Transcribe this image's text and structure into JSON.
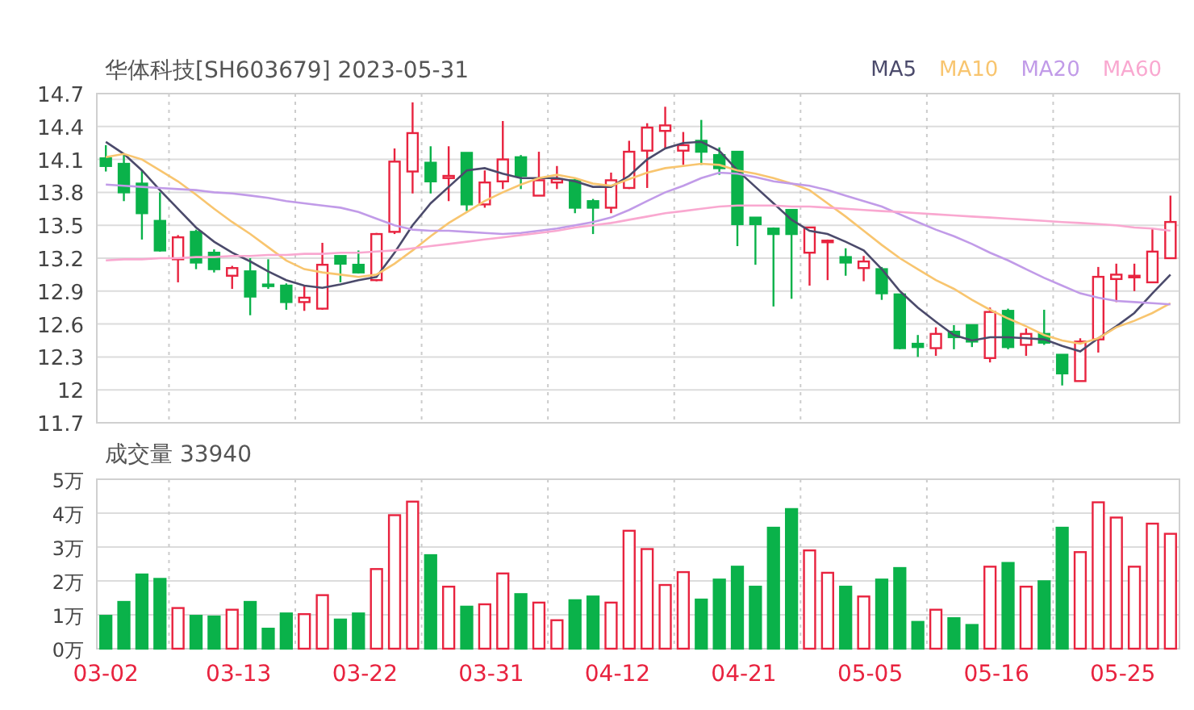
{
  "title": "华体科技[SH603679] 2023-05-31",
  "price_chart": {
    "chart_data": {
      "type": "candlestick",
      "grid": true,
      "categories": [
        null,
        null,
        null,
        null,
        null,
        null,
        null,
        null,
        null,
        null,
        null,
        null,
        null,
        null,
        null,
        null,
        null,
        null,
        null,
        null,
        null,
        null,
        null,
        null,
        null,
        null,
        null,
        null,
        null,
        null,
        null,
        null,
        null,
        null,
        null,
        null,
        null,
        null,
        null,
        null,
        null,
        null,
        null,
        null,
        null,
        null,
        null,
        null,
        null,
        null,
        null,
        null,
        null,
        null,
        null,
        null,
        null,
        null,
        null,
        null
      ],
      "series": [
        {
          "name": "MA5",
          "type": "line",
          "color": "#4b4a6b",
          "values": [
            14.26,
            14.15,
            14.0,
            13.82,
            13.65,
            13.48,
            13.35,
            13.25,
            13.17,
            13.08,
            13.0,
            12.95,
            12.93,
            12.96,
            13.0,
            13.03,
            13.25,
            13.5,
            13.7,
            13.85,
            14.0,
            14.02,
            13.97,
            13.93,
            13.93,
            13.93,
            13.9,
            13.85,
            13.85,
            13.95,
            14.1,
            14.2,
            14.25,
            14.26,
            14.18,
            14.0,
            13.85,
            13.7,
            13.55,
            13.45,
            13.42,
            13.35,
            13.27,
            13.1,
            12.9,
            12.75,
            12.62,
            12.5,
            12.45,
            12.48,
            12.48,
            12.47,
            12.46,
            12.4,
            12.35,
            12.47,
            12.58,
            12.7,
            12.88,
            13.05
          ]
        },
        {
          "name": "MA10",
          "type": "line",
          "color": "#f8c56f",
          "values": [
            14.12,
            14.15,
            14.1,
            14.0,
            13.9,
            13.78,
            13.65,
            13.53,
            13.42,
            13.3,
            13.18,
            13.1,
            13.07,
            13.05,
            13.03,
            13.05,
            13.15,
            13.27,
            13.4,
            13.52,
            13.62,
            13.72,
            13.8,
            13.87,
            13.93,
            13.96,
            13.93,
            13.88,
            13.86,
            13.92,
            13.98,
            14.02,
            14.04,
            14.06,
            14.05,
            14.0,
            13.97,
            13.93,
            13.88,
            13.82,
            13.7,
            13.58,
            13.45,
            13.32,
            13.2,
            13.1,
            13.0,
            12.92,
            12.82,
            12.73,
            12.65,
            12.58,
            12.5,
            12.45,
            12.42,
            12.47,
            12.57,
            12.63,
            12.7,
            12.79
          ]
        },
        {
          "name": "MA20",
          "type": "line",
          "color": "#c19be8",
          "values": [
            13.87,
            13.86,
            13.85,
            13.84,
            13.83,
            13.82,
            13.8,
            13.79,
            13.77,
            13.75,
            13.72,
            13.7,
            13.68,
            13.66,
            13.62,
            13.56,
            13.5,
            13.46,
            13.45,
            13.45,
            13.44,
            13.43,
            13.42,
            13.43,
            13.45,
            13.47,
            13.5,
            13.53,
            13.57,
            13.64,
            13.72,
            13.8,
            13.86,
            13.93,
            13.98,
            13.97,
            13.94,
            13.9,
            13.88,
            13.86,
            13.82,
            13.77,
            13.72,
            13.67,
            13.6,
            13.53,
            13.46,
            13.4,
            13.33,
            13.25,
            13.18,
            13.1,
            13.02,
            12.95,
            12.88,
            12.84,
            12.81,
            12.8,
            12.79,
            12.78
          ]
        },
        {
          "name": "MA60",
          "type": "line",
          "color": "#f9a8d0",
          "values": [
            13.18,
            13.19,
            13.19,
            13.2,
            13.2,
            13.21,
            13.21,
            13.22,
            13.22,
            13.23,
            13.23,
            13.24,
            13.24,
            13.25,
            13.25,
            13.26,
            13.27,
            13.29,
            13.31,
            13.33,
            13.35,
            13.37,
            13.39,
            13.41,
            13.43,
            13.45,
            13.48,
            13.5,
            13.52,
            13.55,
            13.58,
            13.61,
            13.63,
            13.65,
            13.67,
            13.68,
            13.68,
            13.68,
            13.67,
            13.67,
            13.66,
            13.65,
            13.64,
            13.63,
            13.62,
            13.61,
            13.6,
            13.59,
            13.58,
            13.57,
            13.56,
            13.55,
            13.54,
            13.53,
            13.52,
            13.51,
            13.5,
            13.48,
            13.47,
            13.45
          ]
        }
      ],
      "ohlc": [
        [
          14.11,
          14.23,
          13.99,
          14.04
        ],
        [
          14.06,
          14.15,
          13.72,
          13.8
        ],
        [
          13.88,
          14.0,
          13.37,
          13.61
        ],
        [
          13.54,
          13.8,
          13.26,
          13.27
        ],
        [
          13.19,
          13.41,
          12.98,
          13.39
        ],
        [
          13.44,
          13.46,
          13.1,
          13.16
        ],
        [
          13.25,
          13.28,
          13.07,
          13.1
        ],
        [
          13.04,
          13.13,
          12.92,
          13.11
        ],
        [
          13.08,
          13.2,
          12.68,
          12.85
        ],
        [
          12.96,
          13.19,
          12.92,
          12.95
        ],
        [
          12.95,
          12.97,
          12.73,
          12.8
        ],
        [
          12.8,
          12.95,
          12.72,
          12.84
        ],
        [
          12.74,
          13.34,
          12.73,
          13.14
        ],
        [
          13.22,
          13.22,
          12.98,
          13.15
        ],
        [
          13.14,
          13.27,
          13.06,
          13.07
        ],
        [
          13.0,
          13.43,
          12.99,
          13.42
        ],
        [
          13.44,
          14.2,
          13.42,
          14.08
        ],
        [
          13.99,
          14.62,
          13.79,
          14.34
        ],
        [
          14.07,
          14.22,
          13.79,
          13.9
        ],
        [
          13.93,
          14.22,
          13.72,
          13.95
        ],
        [
          14.16,
          14.16,
          13.63,
          13.69
        ],
        [
          13.69,
          14.0,
          13.66,
          13.89
        ],
        [
          13.9,
          14.45,
          13.83,
          14.1
        ],
        [
          14.12,
          14.14,
          13.83,
          13.95
        ],
        [
          13.77,
          14.17,
          13.77,
          13.91
        ],
        [
          13.89,
          14.04,
          13.83,
          13.92
        ],
        [
          13.91,
          13.93,
          13.61,
          13.66
        ],
        [
          13.72,
          13.74,
          13.42,
          13.66
        ],
        [
          13.66,
          13.98,
          13.61,
          13.91
        ],
        [
          13.84,
          14.27,
          13.83,
          14.17
        ],
        [
          14.18,
          14.43,
          13.84,
          14.39
        ],
        [
          14.36,
          14.58,
          14.2,
          14.41
        ],
        [
          14.18,
          14.35,
          14.05,
          14.23
        ],
        [
          14.27,
          14.46,
          14.05,
          14.17
        ],
        [
          14.14,
          14.21,
          13.96,
          14.02
        ],
        [
          14.17,
          14.17,
          13.31,
          13.51
        ],
        [
          13.57,
          13.57,
          13.14,
          13.51
        ],
        [
          13.47,
          13.48,
          12.76,
          13.42
        ],
        [
          13.64,
          13.64,
          12.83,
          13.42
        ],
        [
          13.25,
          13.48,
          12.95,
          13.48
        ],
        [
          13.35,
          13.37,
          13.0,
          13.36
        ],
        [
          13.21,
          13.29,
          13.04,
          13.16
        ],
        [
          13.11,
          13.22,
          12.99,
          13.17
        ],
        [
          13.1,
          13.12,
          12.82,
          12.88
        ],
        [
          12.87,
          12.87,
          12.37,
          12.38
        ],
        [
          12.42,
          12.5,
          12.3,
          12.39
        ],
        [
          12.38,
          12.57,
          12.31,
          12.51
        ],
        [
          12.53,
          12.59,
          12.37,
          12.48
        ],
        [
          12.59,
          12.59,
          12.39,
          12.44
        ],
        [
          12.29,
          12.75,
          12.25,
          12.71
        ],
        [
          12.72,
          12.74,
          12.37,
          12.39
        ],
        [
          12.41,
          12.56,
          12.31,
          12.51
        ],
        [
          12.51,
          12.73,
          12.41,
          12.43
        ],
        [
          12.32,
          12.32,
          12.04,
          12.15
        ],
        [
          12.08,
          12.47,
          12.08,
          12.44
        ],
        [
          12.46,
          13.12,
          12.34,
          13.03
        ],
        [
          13.01,
          13.15,
          12.8,
          13.05
        ],
        [
          13.03,
          13.15,
          12.9,
          13.04
        ],
        [
          12.98,
          13.47,
          12.98,
          13.26
        ],
        [
          13.2,
          13.77,
          13.2,
          13.53
        ]
      ],
      "ylim": [
        11.7,
        14.7
      ],
      "yticks": [
        11.7,
        12,
        12.3,
        12.6,
        12.9,
        13.2,
        13.5,
        13.8,
        14.1,
        14.4,
        14.7
      ]
    }
  },
  "volume_chart": {
    "chart_data": {
      "type": "bar",
      "title": "成交量 33940",
      "grid": true,
      "categories": [
        "03-02",
        null,
        null,
        null,
        null,
        null,
        null,
        "03-13",
        null,
        null,
        null,
        null,
        null,
        null,
        "03-22",
        null,
        null,
        null,
        null,
        null,
        null,
        "03-31",
        null,
        null,
        null,
        null,
        null,
        null,
        "04-12",
        null,
        null,
        null,
        null,
        null,
        null,
        "04-21",
        null,
        null,
        null,
        null,
        null,
        null,
        "05-05",
        null,
        null,
        null,
        null,
        null,
        null,
        "05-16",
        null,
        null,
        null,
        null,
        null,
        null,
        "05-25",
        null,
        null,
        null
      ],
      "series": [
        {
          "color": "#e8233f",
          "values": [
            null,
            null,
            null,
            null,
            1.2,
            null,
            null,
            1.15,
            null,
            null,
            null,
            1.02,
            1.58,
            null,
            null,
            2.35,
            3.94,
            4.34,
            null,
            1.83,
            null,
            1.31,
            2.22,
            null,
            1.36,
            0.84,
            null,
            null,
            1.36,
            3.48,
            2.94,
            1.88,
            2.26,
            null,
            null,
            null,
            null,
            null,
            null,
            2.9,
            2.24,
            null,
            1.54,
            null,
            null,
            null,
            1.15,
            null,
            null,
            2.42,
            null,
            1.83,
            null,
            null,
            2.85,
            4.32,
            3.87,
            2.42,
            3.69,
            3.39
          ]
        },
        {
          "color": "#0ab24a",
          "values": [
            0.97,
            1.38,
            2.19,
            2.06,
            null,
            0.97,
            0.95,
            null,
            1.38,
            0.59,
            1.04,
            null,
            null,
            0.86,
            1.04,
            null,
            null,
            null,
            2.76,
            null,
            1.24,
            null,
            null,
            1.61,
            null,
            null,
            1.43,
            1.54,
            null,
            null,
            null,
            null,
            null,
            1.45,
            2.04,
            2.42,
            1.83,
            3.57,
            4.12,
            null,
            null,
            1.83,
            null,
            2.04,
            2.38,
            0.79,
            null,
            0.9,
            0.7,
            null,
            2.53,
            null,
            1.99,
            3.57,
            null,
            null,
            null,
            null,
            null,
            null
          ]
        }
      ],
      "ylim": [
        0,
        5
      ],
      "yticks": [
        {
          "value": 0,
          "label": "0万"
        },
        {
          "value": 1,
          "label": "1万"
        },
        {
          "value": 2,
          "label": "2万"
        },
        {
          "value": 3,
          "label": "3万"
        },
        {
          "value": 4,
          "label": "4万"
        },
        {
          "value": 5,
          "label": "5万"
        }
      ]
    }
  }
}
